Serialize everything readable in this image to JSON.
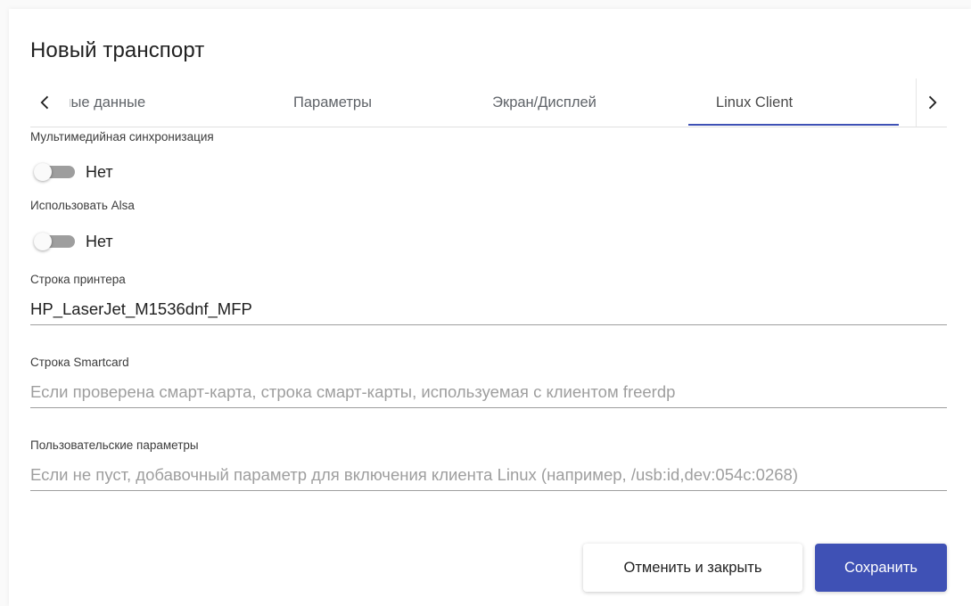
{
  "dialog": {
    "title": "Новый транспорт"
  },
  "tabs": {
    "items": [
      {
        "label": "тные данные",
        "active": false
      },
      {
        "label": "Параметры",
        "active": false
      },
      {
        "label": "Экран/Дисплей",
        "active": false
      },
      {
        "label": "Linux Client",
        "active": true
      }
    ],
    "scroll_left_icon": "chevron-left-icon",
    "scroll_right_icon": "chevron-right-icon",
    "accent_color": "#3f51b5"
  },
  "fields": {
    "multimedia_sync": {
      "label": "Мультимедийная синхронизация",
      "value_text": "Нет",
      "checked": false
    },
    "use_alsa": {
      "label": "Использовать Alsa",
      "value_text": "Нет",
      "checked": false
    },
    "printer_string": {
      "label": "Строка принтера",
      "value": "HP_LaserJet_M1536dnf_MFP",
      "placeholder": ""
    },
    "smartcard_string": {
      "label": "Строка Smartcard",
      "value": "",
      "placeholder": "Если проверена смарт-карта, строка смарт-карты, используемая с клиентом freerdp"
    },
    "custom_params": {
      "label": "Пользовательские параметры",
      "value": "",
      "placeholder": "Если не пуст, добавочный параметр для включения клиента Linux (например, /usb:id,dev:054c:0268)"
    }
  },
  "actions": {
    "cancel_label": "Отменить и закрыть",
    "save_label": "Сохранить",
    "primary_color": "#3f51b5"
  }
}
